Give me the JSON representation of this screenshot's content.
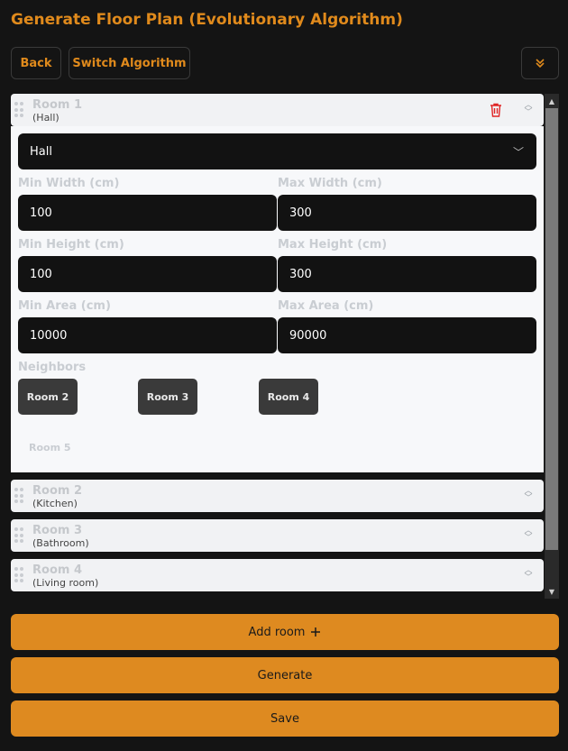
{
  "page_title": "Generate Floor Plan (Evolutionary Algorithm)",
  "toolbar": {
    "back_label": "Back",
    "switch_label": "Switch Algorithm",
    "collapse_icon": "double-chevron-down-icon"
  },
  "rooms": [
    {
      "name": "Room 1",
      "type_label": "(Hall)",
      "expanded": true,
      "type_value": "Hall",
      "fields": {
        "min_width_label": "Min Width (cm)",
        "min_width": "100",
        "max_width_label": "Max Width (cm)",
        "max_width": "300",
        "min_height_label": "Min Height (cm)",
        "min_height": "100",
        "max_height_label": "Max Height (cm)",
        "max_height": "300",
        "min_area_label": "Min Area (cm)",
        "min_area": "10000",
        "max_area_label": "Max Area (cm)",
        "max_area": "90000"
      },
      "neighbors_label": "Neighbors",
      "neighbors": [
        {
          "label": "Room 2",
          "selected": true
        },
        {
          "label": "Room 3",
          "selected": true
        },
        {
          "label": "Room 4",
          "selected": true
        },
        {
          "label": "Room 5",
          "selected": false
        }
      ]
    },
    {
      "name": "Room 2",
      "type_label": "(Kitchen)",
      "expanded": false
    },
    {
      "name": "Room 3",
      "type_label": "(Bathroom)",
      "expanded": false
    },
    {
      "name": "Room 4",
      "type_label": "(Living room)",
      "expanded": false
    }
  ],
  "actions": {
    "add_room_label": "Add room",
    "add_icon": "plus-icon",
    "generate_label": "Generate",
    "save_label": "Save"
  },
  "colors": {
    "accent": "#de8a20",
    "background": "#141414",
    "delete": "#e02424"
  }
}
